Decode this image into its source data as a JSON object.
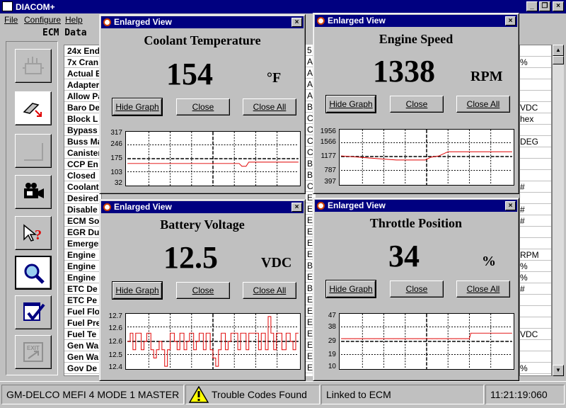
{
  "app": {
    "title": "DIACOM+",
    "title_buttons": [
      "_",
      "❐",
      "×"
    ]
  },
  "menu": [
    {
      "label": "File"
    },
    {
      "label": "Configure"
    },
    {
      "label": "Help"
    }
  ],
  "ecm_header": "ECM Data",
  "toolbar": [
    {
      "icon": "engine-icon"
    },
    {
      "icon": "connector-icon"
    },
    {
      "icon": "blank-icon"
    },
    {
      "icon": "camera-icon"
    },
    {
      "icon": "help-icon"
    },
    {
      "icon": "magnifier-icon"
    },
    {
      "icon": "checklist-icon"
    },
    {
      "icon": "exit-icon",
      "label": "EXIT"
    }
  ],
  "list_names": [
    "24x End",
    "7x Cran",
    "Actual E",
    "Adapter",
    "Allow Pa",
    "Baro De",
    "Block L",
    "Bypass",
    "Buss Ma",
    "Canister",
    "CCP En",
    "Closed",
    "Coolant",
    "Desired",
    "Disable",
    "ECM So",
    "EGR Du",
    "Emerger",
    "Engine",
    "Engine",
    "Engine",
    "ETC De",
    "ETC Pe",
    "Fuel Flo",
    "Fuel Pre",
    "Fuel Te",
    "Gen Wa",
    "Gen Wa",
    "Gov De"
  ],
  "list_col2": [
    "5",
    "A",
    "A",
    "A",
    "A",
    "B",
    "C",
    "C",
    "C",
    "C",
    "B",
    "B",
    "C",
    "E",
    "E",
    "E",
    "E",
    "E",
    "E",
    "B",
    "E",
    "B",
    "E",
    "E",
    "E",
    "E",
    "E",
    "E",
    "E"
  ],
  "list_col3": [
    "",
    "%",
    "",
    "",
    "",
    "VDC",
    "hex",
    "",
    "DEG",
    "",
    "",
    "",
    "#",
    "",
    "#",
    "#",
    "",
    "",
    "RPM",
    "%",
    "%",
    "#",
    "",
    "",
    "",
    "VDC",
    "",
    "",
    "%"
  ],
  "windows": [
    {
      "title": "Enlarged View",
      "name": "Coolant Temperature",
      "value": "154",
      "unit": "°F",
      "buttons": {
        "hide": "Hide Graph",
        "close": "Close",
        "close_all": "Close All"
      },
      "yticks": [
        "317",
        "246",
        "175",
        "103",
        "32"
      ]
    },
    {
      "title": "Enlarged View",
      "name": "Engine Speed",
      "value": "1338",
      "unit": "RPM",
      "buttons": {
        "hide": "Hide Graph",
        "close": "Close",
        "close_all": "Close All"
      },
      "yticks": [
        "1956",
        "1566",
        "1177",
        "787",
        "397"
      ]
    },
    {
      "title": "Enlarged View",
      "name": "Battery Voltage",
      "value": "12.5",
      "unit": "VDC",
      "buttons": {
        "hide": "Hide Graph",
        "close": "Close",
        "close_all": "Close All"
      },
      "yticks": [
        "12.7",
        "12.6",
        "12.6",
        "12.5",
        "12.4"
      ]
    },
    {
      "title": "Enlarged View",
      "name": "Throttle Position",
      "value": "34",
      "unit": "%",
      "buttons": {
        "hide": "Hide Graph",
        "close": "Close",
        "close_all": "Close All"
      },
      "yticks": [
        "47",
        "38",
        "29",
        "19",
        "10"
      ]
    }
  ],
  "status": {
    "device": "GM-DELCO MEFI 4 MODE 1 MASTER",
    "codes": "Trouble Codes Found",
    "link": "Linked to ECM",
    "time": "11:21:19:060"
  },
  "colors": {
    "title_bar": "#000080",
    "trace": "#e00000"
  }
}
